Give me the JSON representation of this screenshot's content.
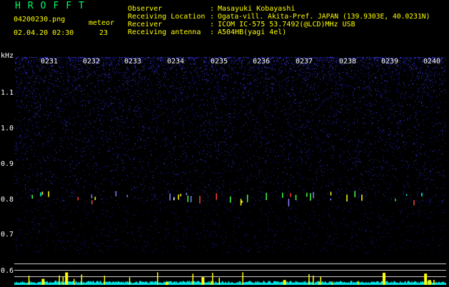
{
  "header": {
    "app_name": "HROFFT",
    "file_name": "04200230.png",
    "datetime": "02.04.20 02:30",
    "meteor_label": "meteor",
    "meteor_count": "23",
    "fields": [
      {
        "label": "Observer",
        "value": "Masayuki Kobayashi"
      },
      {
        "label": "Receiving Location",
        "value": "Ogata-vill. Akita-Pref. JAPAN (139.9303E, 40.0231N)"
      },
      {
        "label": "Receiver",
        "value": "ICOM IC-575 53.7492(@LCD)MHz USB"
      },
      {
        "label": "Receiving antenna",
        "value": "A504HB(yagi 4el)"
      }
    ],
    "separator": ":"
  },
  "axis": {
    "unit": "kHz",
    "ticks": [
      "1.1",
      "1.0",
      "0.9",
      "0.8",
      "0.7",
      "0.6"
    ],
    "time_labels": [
      "0231",
      "0232",
      "0233",
      "0234",
      "0235",
      "0236",
      "0237",
      "0238",
      "0239",
      "0240"
    ]
  },
  "colors": {
    "app_name": "#00ff66",
    "info_text": "#ffff00",
    "noise": "#1a1aa0",
    "background": "#000000",
    "power_fill": "#00e5e5",
    "power_peak": "#ffff00",
    "guide_line": "#c8c8c8"
  }
}
